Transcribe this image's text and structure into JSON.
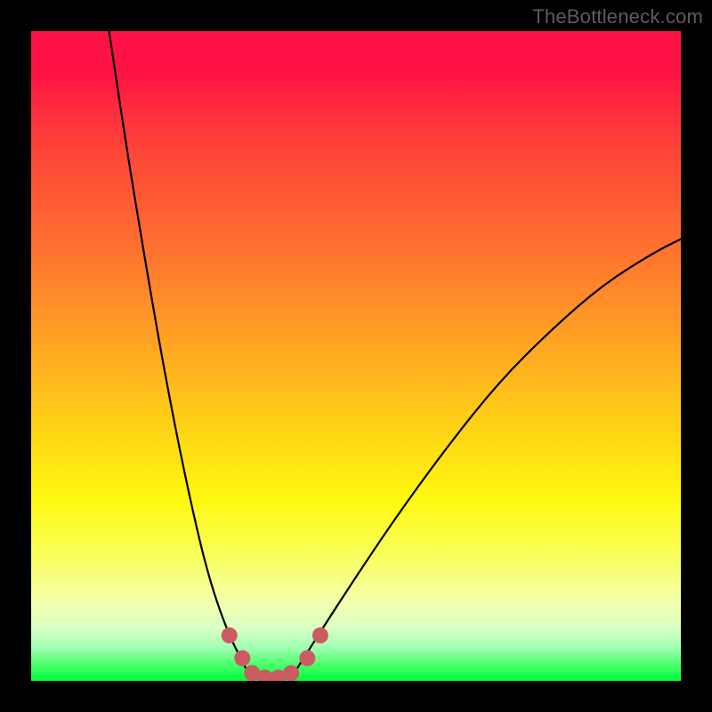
{
  "watermark": {
    "text": "TheBottleneck.com"
  },
  "colors": {
    "background": "#000000",
    "curve_stroke": "#000000",
    "marker": "#cc5a63",
    "gradient_stops": [
      "#ff1245",
      "#ff1245",
      "#ff4438",
      "#ff7330",
      "#ffa423",
      "#ffd615",
      "#fff80f",
      "#faff55",
      "#f3ffad",
      "#d7ffc5",
      "#9dffb2",
      "#4aff6a",
      "#00ff3a"
    ]
  },
  "chart_data": {
    "type": "line",
    "title": "",
    "xlabel": "",
    "ylabel": "",
    "xlim": [
      0,
      100
    ],
    "ylim": [
      0,
      100
    ],
    "grid": false,
    "legend": false,
    "annotations": [],
    "series": [
      {
        "name": "left-branch",
        "x": [
          12,
          15,
          18,
          21,
          24,
          27,
          30,
          33
        ],
        "values": [
          100,
          80,
          62,
          45,
          30,
          17,
          8,
          2
        ]
      },
      {
        "name": "valley-floor",
        "x": [
          33,
          35,
          37,
          39,
          41
        ],
        "values": [
          2,
          0.5,
          0,
          0.5,
          2
        ]
      },
      {
        "name": "right-branch",
        "x": [
          41,
          48,
          56,
          64,
          72,
          80,
          88,
          96,
          100
        ],
        "values": [
          2,
          13,
          25,
          36,
          46,
          54,
          61,
          66,
          68
        ]
      }
    ],
    "markers": {
      "name": "valley-markers",
      "x": [
        30.5,
        32.5,
        34,
        36,
        38,
        40,
        42.5,
        44.5
      ],
      "values": [
        7,
        3.5,
        1.2,
        0.5,
        0.5,
        1.2,
        3.5,
        7
      ],
      "color": "#cc5a63",
      "radius_px": 9
    }
  }
}
